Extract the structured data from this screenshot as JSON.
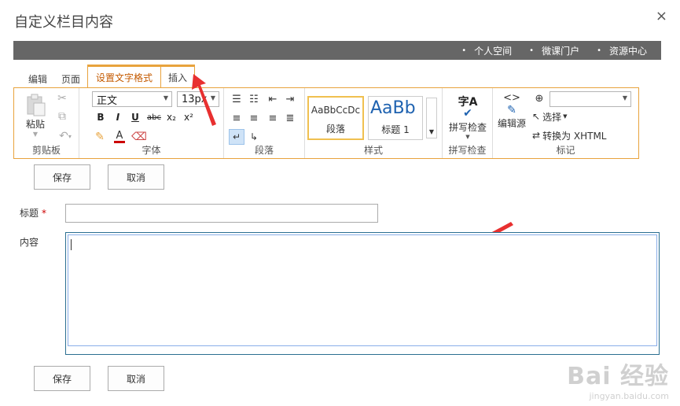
{
  "dialog": {
    "title": "自定义栏目内容",
    "close_label": "×"
  },
  "topbar": {
    "links": [
      "个人空间",
      "微课门户",
      "资源中心"
    ]
  },
  "tabs": [
    "编辑",
    "页面",
    "设置文字格式",
    "插入"
  ],
  "ribbon": {
    "clipboard": {
      "paste_label": "粘贴",
      "group_label": "剪贴板"
    },
    "font": {
      "font_name": "正文",
      "font_size": "13px",
      "bold": "B",
      "italic": "I",
      "underline": "U",
      "strike": "abc",
      "subscript": "x₂",
      "superscript": "x²",
      "group_label": "字体"
    },
    "paragraph": {
      "group_label": "段落"
    },
    "styles": {
      "items": [
        {
          "sample": "AaBbCcDc",
          "name": "段落"
        },
        {
          "sample": "AaBb",
          "name": "标题 1"
        }
      ],
      "group_label": "样式"
    },
    "spellcheck": {
      "icon_text": "字A",
      "label": "拼写检查",
      "group_label": "拼写检查"
    },
    "markup": {
      "edit_source_label": "编辑源",
      "select_label": "选择",
      "convert_label": "转换为 XHTML",
      "group_label": "标记"
    }
  },
  "form": {
    "save_label": "保存",
    "cancel_label": "取消",
    "title_label": "标题",
    "required_mark": "*",
    "content_label": "内容",
    "title_value": ""
  },
  "watermark": {
    "logo": "Bai 经验",
    "url": "jingyan.baidu.com"
  },
  "colors": {
    "accent": "#e8a33d",
    "topbar": "#666666",
    "arrow": "#e83030"
  }
}
